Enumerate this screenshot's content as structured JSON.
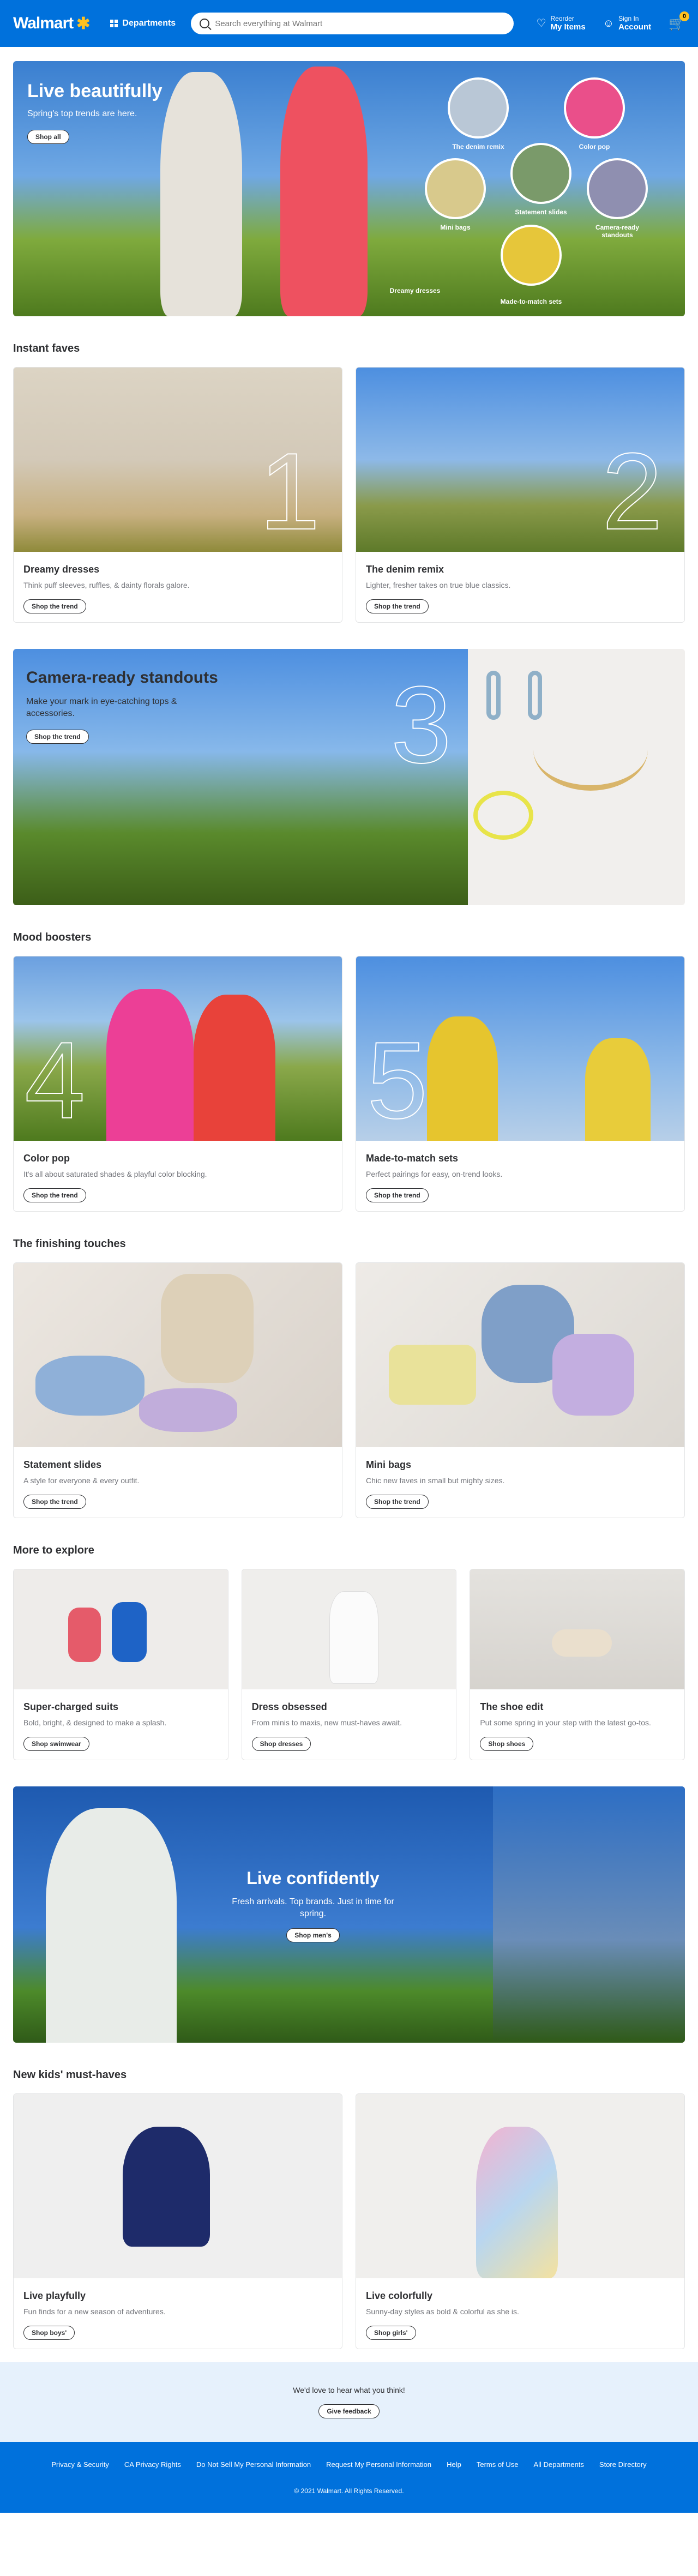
{
  "header": {
    "logo": "Walmart",
    "departments": "Departments",
    "search_placeholder": "Search everything at Walmart",
    "reorder_top": "Reorder",
    "reorder_bottom": "My Items",
    "signin_top": "Sign In",
    "signin_bottom": "Account",
    "cart_count": "0"
  },
  "hero": {
    "title": "Live beautifully",
    "subtitle": "Spring's top trends are here.",
    "button": "Shop all",
    "circles": [
      "The denim remix",
      "Color pop",
      "Mini bags",
      "Statement slides",
      "Camera-ready standouts",
      "Dreamy dresses",
      "Made-to-match sets"
    ]
  },
  "instant_faves": {
    "title": "Instant faves",
    "cards": [
      {
        "num": "1",
        "title": "Dreamy dresses",
        "desc": "Think puff sleeves, ruffles, & dainty florals galore.",
        "button": "Shop the trend"
      },
      {
        "num": "2",
        "title": "The denim remix",
        "desc": "Lighter, fresher takes on true blue classics.",
        "button": "Shop the trend"
      }
    ]
  },
  "camera": {
    "num": "3",
    "title": "Camera-ready standouts",
    "desc": "Make your mark in eye-catching tops & accessories.",
    "button": "Shop the trend"
  },
  "mood": {
    "title": "Mood boosters",
    "cards": [
      {
        "num": "4",
        "title": "Color pop",
        "desc": "It's all about saturated shades & playful color blocking.",
        "button": "Shop the trend"
      },
      {
        "num": "5",
        "title": "Made-to-match sets",
        "desc": "Perfect pairings for easy, on-trend looks.",
        "button": "Shop the trend"
      }
    ]
  },
  "finishing": {
    "title": "The finishing touches",
    "cards": [
      {
        "title": "Statement slides",
        "desc": "A style for everyone & every outfit.",
        "button": "Shop the trend"
      },
      {
        "title": "Mini bags",
        "desc": "Chic new faves in small but mighty sizes.",
        "button": "Shop the trend"
      }
    ]
  },
  "explore": {
    "title": "More to explore",
    "cards": [
      {
        "title": "Super-charged suits",
        "desc": "Bold, bright, & designed to make a splash.",
        "button": "Shop swimwear"
      },
      {
        "title": "Dress obsessed",
        "desc": "From minis to maxis, new must-haves await.",
        "button": "Shop dresses"
      },
      {
        "title": "The shoe edit",
        "desc": "Put some spring in your step with the latest go-tos.",
        "button": "Shop shoes"
      }
    ]
  },
  "confident": {
    "title": "Live confidently",
    "desc": "Fresh arrivals. Top brands. Just in time for spring.",
    "button": "Shop men's"
  },
  "kids": {
    "title": "New kids' must-haves",
    "cards": [
      {
        "title": "Live playfully",
        "desc": "Fun finds for a new season of adventures.",
        "button": "Shop boys'"
      },
      {
        "title": "Live colorfully",
        "desc": "Sunny-day styles as bold & colorful as she is.",
        "button": "Shop girls'"
      }
    ]
  },
  "feedback": {
    "text": "We'd love to hear what you think!",
    "button": "Give feedback"
  },
  "footer": {
    "links": [
      "Privacy & Security",
      "CA Privacy Rights",
      "Do Not Sell My Personal Information",
      "Request My Personal Information",
      "Help",
      "Terms of Use",
      "All Departments",
      "Store Directory"
    ],
    "copyright": "© 2021 Walmart. All Rights Reserved."
  }
}
